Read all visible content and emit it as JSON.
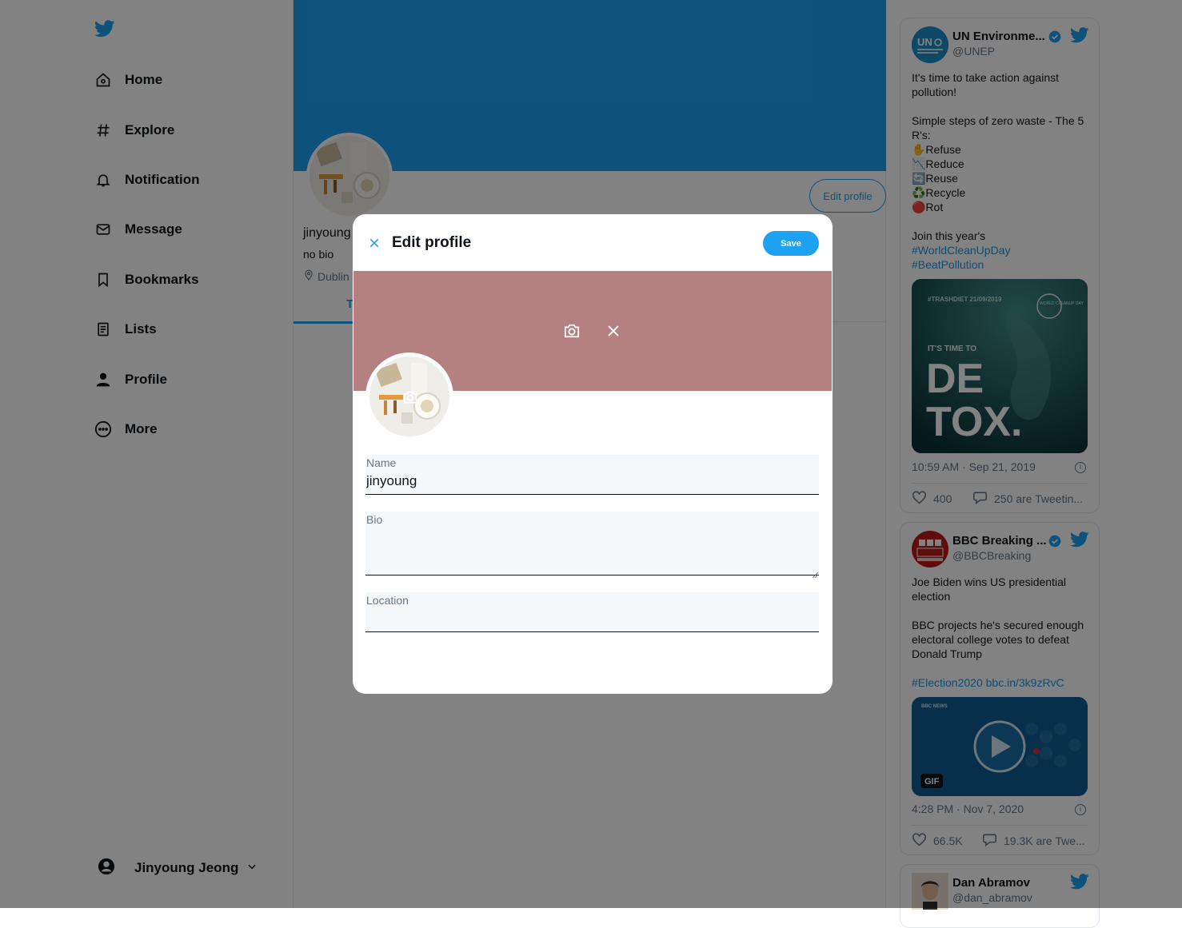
{
  "sidebar": {
    "logo_icon": "twitter-bird-icon",
    "items": [
      {
        "label": "Home",
        "icon": "home-icon"
      },
      {
        "label": "Explore",
        "icon": "hashtag-icon"
      },
      {
        "label": "Notification",
        "icon": "bell-icon"
      },
      {
        "label": "Message",
        "icon": "mail-icon"
      },
      {
        "label": "Bookmarks",
        "icon": "bookmark-icon"
      },
      {
        "label": "Lists",
        "icon": "list-icon"
      },
      {
        "label": "Profile",
        "icon": "person-icon"
      },
      {
        "label": "More",
        "icon": "more-circle-icon"
      }
    ],
    "account_name": "Jinyoung Jeong"
  },
  "profile": {
    "name": "jinyoung",
    "bio": "no bio",
    "location": "Dublin",
    "edit_button": "Edit profile",
    "tab_partial": "T"
  },
  "modal": {
    "title": "Edit profile",
    "save_label": "Save",
    "fields": {
      "name_label": "Name",
      "name_value": "jinyoung",
      "bio_label": "Bio",
      "bio_value": "",
      "location_label": "Location",
      "location_value": ""
    }
  },
  "tweets": [
    {
      "name": "UN Environme...",
      "handle": "@UNEP",
      "text_1": "It's time to take action against pollution!\n\nSimple steps of zero waste - The 5 R's:\n✋Refuse\n📉Reduce\n🔄Reuse\n♻️Recycle\n🔴Rot\n\nJoin this year's",
      "link_1": "#WorldCleanUpDay",
      "link_2": "#BeatPollution",
      "media_tag": "#TRASHDIET 21/09/2019",
      "media_line1": "IT'S TIME TO",
      "media_line2": "DE",
      "media_line3": "TOX.",
      "media_badge": "WORLD CLEANUP DAY",
      "time": "10:59 AM · Sep 21, 2019",
      "likes": "400",
      "replies": "250 are Tweetin..."
    },
    {
      "name": "BBC Breaking ...",
      "handle": "@BBCBreaking",
      "text_1": "Joe Biden wins US presidential election\n\nBBC projects he's secured enough electoral college votes to defeat Donald Trump",
      "link_1": "#Election2020 bbc.in/3k9zRvC",
      "media_tag": "BBC NEWS",
      "media_badge": "GIF",
      "time": "4:28 PM · Nov 7, 2020",
      "likes": "66.5K",
      "replies": "19.3K are Twe..."
    },
    {
      "name": "Dan Abramov",
      "handle": "@dan_abramov"
    }
  ],
  "colors": {
    "brand": "#1da1f2",
    "banner_profile": "#1da1f2",
    "banner_modal": "#b48080",
    "overlay": "rgba(0,0,0,0.49)"
  }
}
